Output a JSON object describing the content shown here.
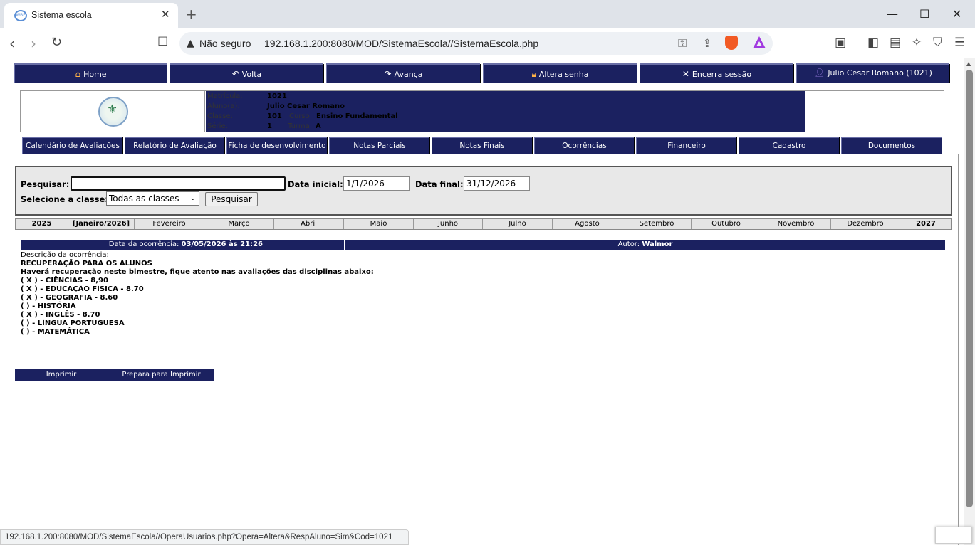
{
  "browser": {
    "tab_title": "Sistema escola",
    "favicon_text": "WBF",
    "address_warning": "Não seguro",
    "url": "192.168.1.200:8080/MOD/SistemaEscola//SistemaEscola.php",
    "status_url": "192.168.1.200:8080/MOD/SistemaEscola//OperaUsuarios.php?Opera=Altera&RespAluno=Sim&Cod=1021"
  },
  "topnav": {
    "home": "Home",
    "back": "Volta",
    "forward": "Avança",
    "change_password": "Altera senha",
    "logout": "Encerra sessão",
    "user": "Julio Cesar Romano (1021)"
  },
  "student": {
    "matricula_label": "Matrícula:",
    "matricula": "1021",
    "aluno_label": "Aluno(a):",
    "aluno": "Julio Cesar Romano",
    "classe_label": "Classe:",
    "classe": "101",
    "curso_label": "Curso:",
    "curso": "Ensino Fundamental",
    "serie_label": "Série:",
    "serie": "1",
    "turma_label": "Turma:",
    "turma": "A"
  },
  "subnav": [
    "Calendário de Avaliações",
    "Relatório de Avaliação",
    "Ficha de desenvolvimento",
    "Notas Parciais",
    "Notas Finais",
    "Ocorrências",
    "Financeiro",
    "Cadastro",
    "Documentos"
  ],
  "search": {
    "search_label": "Pesquisar:",
    "search_value": "",
    "start_label": "Data inicial:",
    "start_value": "1/1/2026",
    "end_label": "Data final:",
    "end_value": "31/12/2026",
    "class_label": "Selecione a classe:",
    "class_selected": "Todas as classes",
    "search_button": "Pesquisar"
  },
  "months": [
    "2025",
    "[Janeiro/2026]",
    "Fevereiro",
    "Março",
    "Abril",
    "Maio",
    "Junho",
    "Julho",
    "Agosto",
    "Setembro",
    "Outubro",
    "Novembro",
    "Dezembro",
    "2027"
  ],
  "occurrence": {
    "date_label": "Data da ocorrência:",
    "date_value": "03/05/2026 às 21:26",
    "author_label": "Autor:",
    "author_value": "Walmor",
    "description_label": "Descrição da ocorrência:",
    "lines": [
      "RECUPERAÇÃO PARA OS ALUNOS",
      "Haverá recuperação neste bimestre, fique atento nas avaliações das disciplinas abaixo:",
      "( X ) - CIÊNCIAS - 8,90",
      "( X ) - EDUCAÇÃO FÍSICA - 8.70",
      "( X ) - GEOGRAFIA - 8.60",
      "( ) - HISTÓRIA",
      "( X ) - INGLÊS - 8.70",
      "( ) - LÍNGUA PORTUGUESA",
      "( ) - MATEMÁTICA"
    ]
  },
  "print": {
    "print": "Imprimir",
    "prepare": "Prepara para Imprimir"
  }
}
